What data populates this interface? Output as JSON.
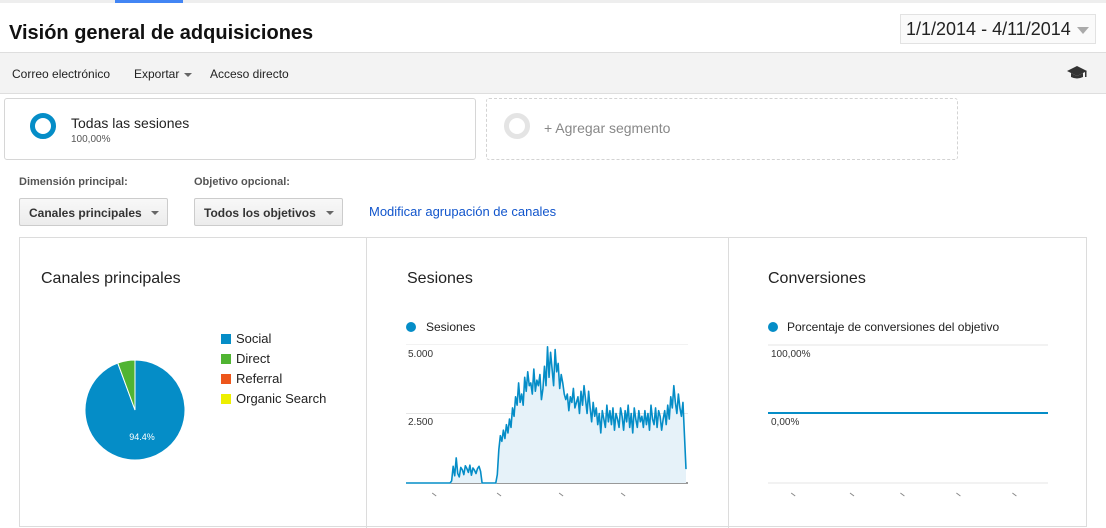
{
  "header": {
    "title": "Visión general de adquisiciones",
    "date_range": "1/1/2014 - 4/11/2014"
  },
  "toolbar": {
    "email_label": "Correo electrónico",
    "export_label": "Exportar",
    "shortcut_label": "Acceso directo",
    "help_icon": "graduation-cap-icon"
  },
  "segments": {
    "main": {
      "name": "Todas las sesiones",
      "percent": "100,00%"
    },
    "add_label": "+ Agregar segmento"
  },
  "controls": {
    "primary_dimension_label": "Dimensión principal:",
    "primary_dimension_value": "Canales principales",
    "goal_label": "Objetivo opcional:",
    "goal_value": "Todos los objetivos",
    "modify_link": "Modificar agrupación de canales"
  },
  "panels": {
    "channels": {
      "title": "Canales principales",
      "legend": [
        {
          "label": "Social",
          "color": "#058dc7"
        },
        {
          "label": "Direct",
          "color": "#50b432"
        },
        {
          "label": "Referral",
          "color": "#ed561b"
        },
        {
          "label": "Organic Search",
          "color": "#edef00"
        }
      ],
      "slice_label": "94.4%"
    },
    "sessions": {
      "title": "Sesiones",
      "series_label": "Sesiones",
      "y_ticks": [
        "5.000",
        "2.500"
      ]
    },
    "conversions": {
      "title": "Conversiones",
      "series_label": "Porcentaje de conversiones del objetivo",
      "y_ticks": [
        "100,00%",
        "0,00%"
      ]
    }
  },
  "chart_data": [
    {
      "type": "pie",
      "title": "Canales principales",
      "categories": [
        "Social",
        "Direct",
        "Referral",
        "Organic Search"
      ],
      "values": [
        94.4,
        5.6,
        0,
        0
      ],
      "colors": [
        "#058dc7",
        "#50b432",
        "#ed561b",
        "#edef00"
      ]
    },
    {
      "type": "area",
      "title": "Sesiones",
      "series": [
        {
          "name": "Sesiones",
          "values": [
            0,
            0,
            0,
            0,
            0,
            0,
            0,
            0,
            0,
            0,
            0,
            0,
            0,
            0,
            0,
            0,
            0,
            0,
            0,
            0,
            0,
            0,
            0,
            0,
            0,
            0,
            0,
            0,
            0,
            0,
            80,
            600,
            260,
            900,
            340,
            220,
            560,
            480,
            300,
            620,
            520,
            380,
            640,
            280,
            540,
            460,
            340,
            520,
            600,
            420,
            0,
            0,
            0,
            0,
            0,
            0,
            0,
            0,
            0,
            0,
            300,
            1200,
            1700,
            1500,
            1900,
            1600,
            2100,
            1800,
            2300,
            2000,
            2700,
            2400,
            3100,
            2800,
            3600,
            2900,
            3200,
            2800,
            3800,
            3300,
            4000,
            3500,
            3600,
            3200,
            4100,
            3300,
            3700,
            3500,
            3900,
            3000,
            3400,
            4200,
            3500,
            4900,
            3800,
            4700,
            4100,
            3500,
            4800,
            4000,
            4300,
            3400,
            3900,
            3600,
            3200,
            3000,
            3200,
            2600,
            3100,
            2900,
            3400,
            2700,
            2900,
            3100,
            2500,
            3300,
            2800,
            3500,
            3000,
            2500,
            3300,
            2700,
            2200,
            2900,
            2400,
            2700,
            2100,
            2500,
            1800,
            2600,
            2300,
            2000,
            2800,
            2200,
            2600,
            2100,
            2700,
            1900,
            2500,
            2300,
            2000,
            2700,
            2400,
            1900,
            2600,
            2200,
            2800,
            2000,
            2500,
            1800,
            2700,
            2300,
            2000,
            2600,
            2200,
            2400,
            2000,
            2600,
            2100,
            2500,
            1900,
            2800,
            2300,
            2100,
            2700,
            2000,
            2600,
            2400,
            1900,
            2300,
            2600,
            2100,
            2800,
            2300,
            3100,
            2700,
            3500,
            2900,
            2500,
            3200,
            2700,
            2400,
            2900,
            1700,
            500
          ]
        }
      ],
      "ylim": [
        0,
        5000
      ],
      "y_ticks": [
        2500,
        5000
      ]
    },
    {
      "type": "line",
      "title": "Conversiones",
      "series": [
        {
          "name": "Porcentaje de conversiones del objetivo",
          "values": [
            0,
            0
          ]
        }
      ],
      "ylim": [
        0,
        100
      ]
    }
  ]
}
